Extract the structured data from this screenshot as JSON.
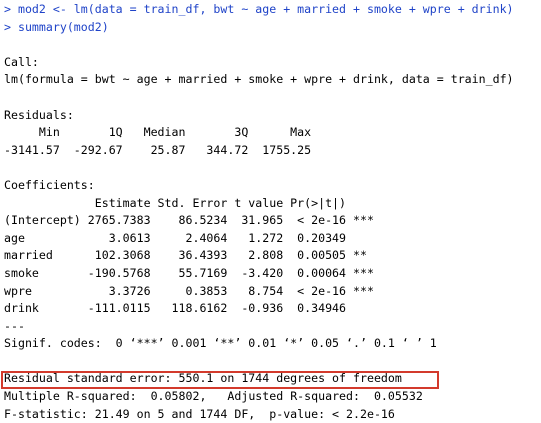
{
  "colors": {
    "command_text": "#1f43c8",
    "output_text": "#000000",
    "highlight_border": "#d33a2c",
    "background": "#ffffff"
  },
  "commands": {
    "line1": "> mod2 <- lm(data = train_df, bwt ~ age + married + smoke + wpre + drink)",
    "line2": "> summary(mod2)"
  },
  "call": {
    "header": "Call:",
    "formula": "lm(formula = bwt ~ age + married + smoke + wpre + drink, data = train_df)"
  },
  "residuals": {
    "header": "Residuals:",
    "labels_row": "     Min       1Q   Median       3Q      Max ",
    "values_row": "-3141.57  -292.67    25.87   344.72  1755.25 "
  },
  "coefficients": {
    "header": "Coefficients:",
    "columns_row": "             Estimate Std. Error t value Pr(>|t|)    ",
    "rows": [
      "(Intercept) 2765.7383    86.5234  31.965  < 2e-16 ***",
      "age            3.0613     2.4064   1.272  0.20349    ",
      "married      102.3068    36.4393   2.808  0.00505 ** ",
      "smoke       -190.5768    55.7169  -3.420  0.00064 ***",
      "wpre           3.3726     0.3853   8.754  < 2e-16 ***",
      "drink       -111.0115   118.6162  -0.936  0.34946    "
    ],
    "separator": "---",
    "signif_codes": "Signif. codes:  0 ‘***’ 0.001 ‘**’ 0.01 ‘*’ 0.05 ‘.’ 0.1 ‘ ’ 1"
  },
  "summary": {
    "residual_se": "Residual standard error: 550.1 on 1744 degrees of freedom",
    "r_squared": "Multiple R-squared:  0.05802,\tAdjusted R-squared:  0.05532 ",
    "f_statistic": "F-statistic: 21.49 on 5 and 1744 DF,  p-value: < 2.2e-16"
  }
}
